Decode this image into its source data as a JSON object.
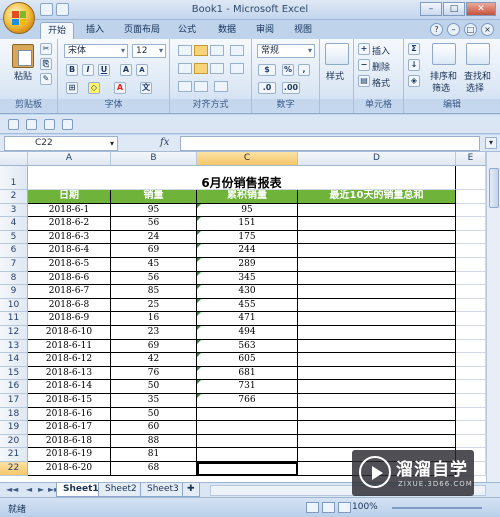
{
  "window": {
    "title": "Book1 - Microsoft Excel",
    "min": "–",
    "max": "□",
    "close": "✕"
  },
  "tabs": [
    "开始",
    "插入",
    "页面布局",
    "公式",
    "数据",
    "审阅",
    "视图"
  ],
  "ribbon": {
    "clipboard": {
      "paste": "粘贴",
      "label": "剪贴板"
    },
    "font": {
      "name": "宋体",
      "size": "12",
      "bold": "B",
      "italic": "I",
      "underline": "U",
      "grow": "A",
      "shrink": "A",
      "wen": "文",
      "label": "字体"
    },
    "align": {
      "label": "对齐方式"
    },
    "number": {
      "format": "常规",
      "percent": "%",
      "comma": ",",
      "label": "数字"
    },
    "styles": {
      "styles": "样式",
      "label": ""
    },
    "cells": {
      "insert": "插入",
      "delete": "删除",
      "format": "格式",
      "label": "单元格"
    },
    "edit": {
      "sigma": "Σ",
      "sort": "排序和",
      "filter": "筛选",
      "find": "查找和",
      "select": "选择",
      "label": "编辑"
    }
  },
  "formula_bar": {
    "name_box": "C22",
    "fx": "fx",
    "value": ""
  },
  "sheet": {
    "columns": [
      "A",
      "B",
      "C",
      "D",
      "E"
    ],
    "title": "6月份销售报表",
    "headers": [
      "日期",
      "销量",
      "累积销量",
      "最近10天的销量总和"
    ],
    "rows": [
      [
        "2018-6-1",
        "95",
        "95",
        ""
      ],
      [
        "2018-6-2",
        "56",
        "151",
        ""
      ],
      [
        "2018-6-3",
        "24",
        "175",
        ""
      ],
      [
        "2018-6-4",
        "69",
        "244",
        ""
      ],
      [
        "2018-6-5",
        "45",
        "289",
        ""
      ],
      [
        "2018-6-6",
        "56",
        "345",
        ""
      ],
      [
        "2018-6-7",
        "85",
        "430",
        ""
      ],
      [
        "2018-6-8",
        "25",
        "455",
        ""
      ],
      [
        "2018-6-9",
        "16",
        "471",
        ""
      ],
      [
        "2018-6-10",
        "23",
        "494",
        ""
      ],
      [
        "2018-6-11",
        "69",
        "563",
        ""
      ],
      [
        "2018-6-12",
        "42",
        "605",
        ""
      ],
      [
        "2018-6-13",
        "76",
        "681",
        ""
      ],
      [
        "2018-6-14",
        "50",
        "731",
        ""
      ],
      [
        "2018-6-15",
        "35",
        "766",
        ""
      ],
      [
        "2018-6-16",
        "50",
        "",
        ""
      ],
      [
        "2018-6-17",
        "60",
        "",
        ""
      ],
      [
        "2018-6-18",
        "88",
        "",
        ""
      ],
      [
        "2018-6-19",
        "81",
        "",
        ""
      ],
      [
        "2018-6-20",
        "68",
        "",
        ""
      ]
    ],
    "row_numbers": [
      "1",
      "2",
      "3",
      "4",
      "5",
      "6",
      "7",
      "8",
      "9",
      "10",
      "11",
      "12",
      "13",
      "14",
      "15",
      "16",
      "17",
      "18",
      "19",
      "20",
      "21",
      "22"
    ],
    "selected_cell": "C22"
  },
  "sheet_tabs": [
    "Sheet1",
    "Sheet2",
    "Sheet3"
  ],
  "status": {
    "ready": "就绪",
    "zoom": "100%"
  },
  "watermark": {
    "text": "溜溜自学",
    "sub": "ZIXUE.3D66.COM"
  },
  "colors": {
    "header_green": "#6fb33b",
    "selection": "#f5c76a"
  }
}
